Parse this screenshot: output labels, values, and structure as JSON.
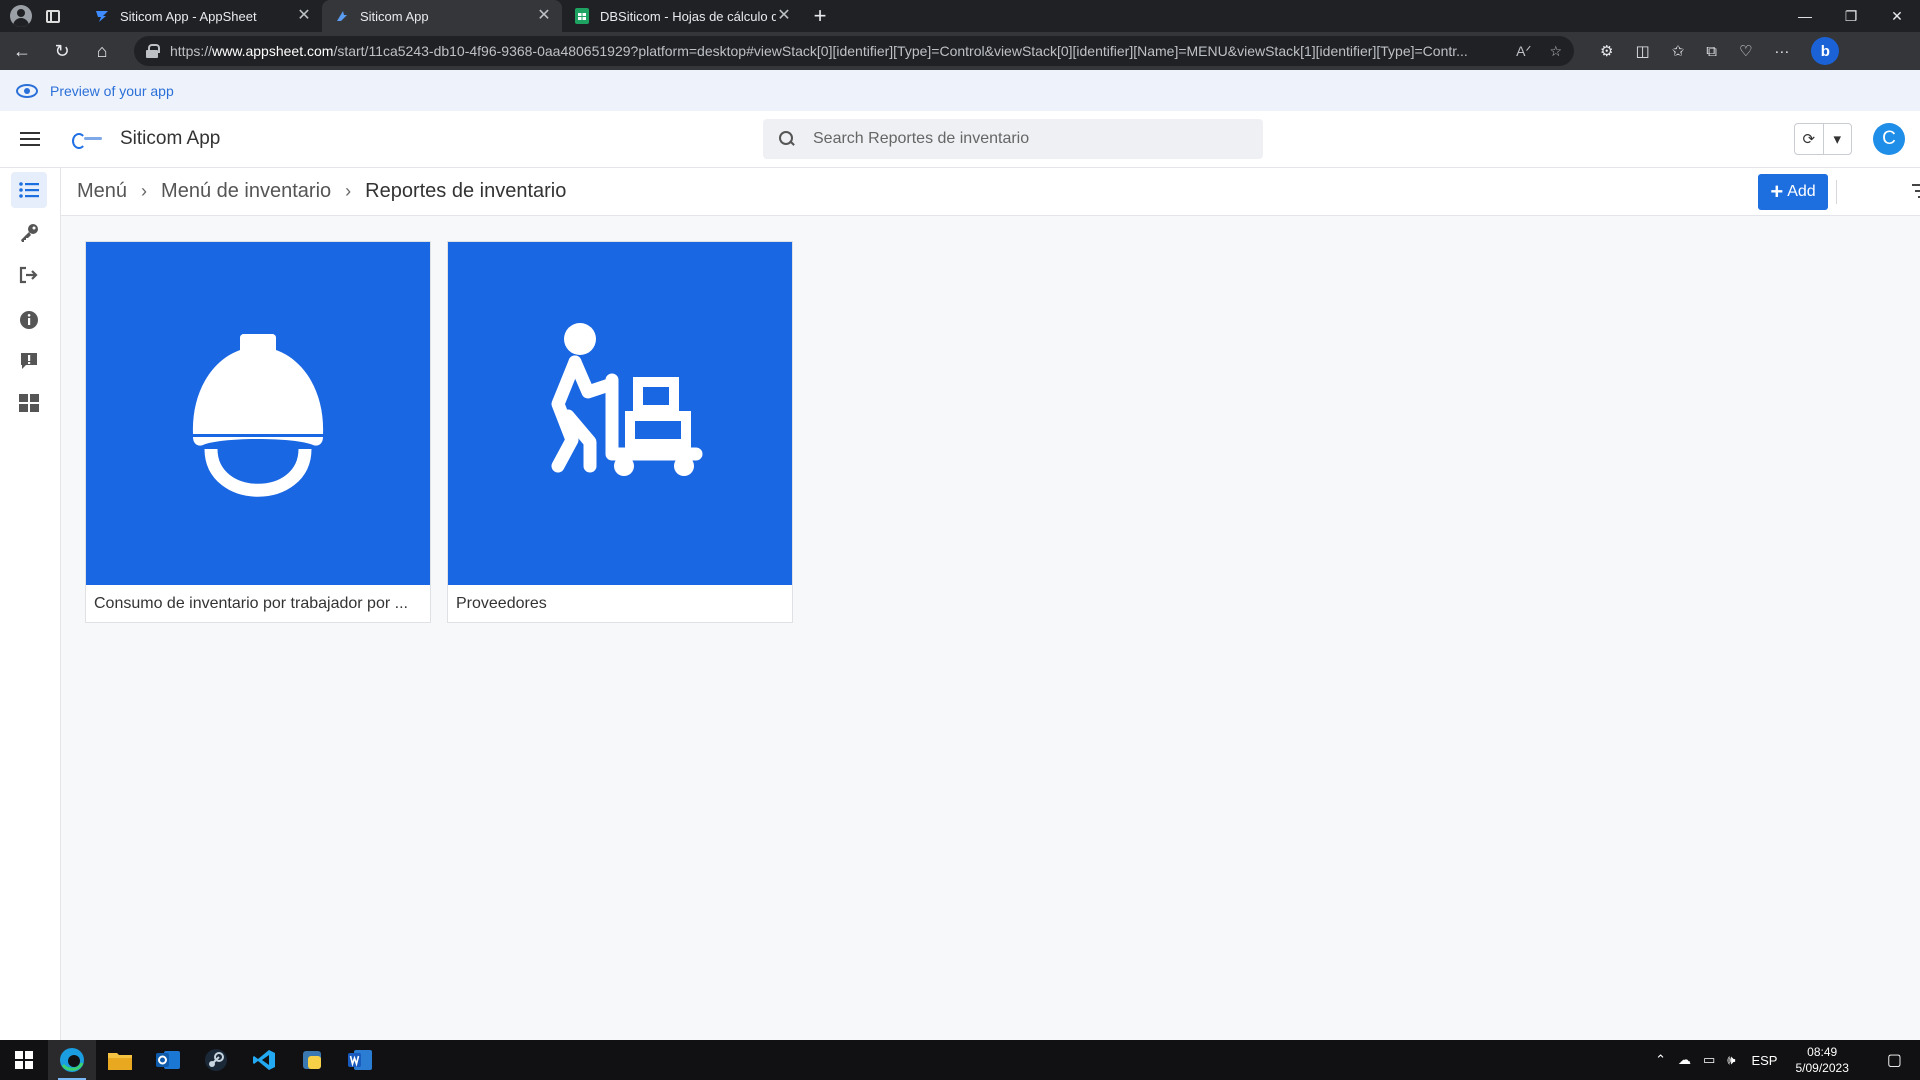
{
  "browser": {
    "tabs": [
      {
        "title": "Siticom App - AppSheet",
        "active": false
      },
      {
        "title": "Siticom App",
        "active": true
      },
      {
        "title": "DBSiticom - Hojas de cálculo de",
        "active": false
      }
    ],
    "url_host": "www.appsheet.com",
    "url_prefix": "https://",
    "url_rest": "/start/11ca5243-db10-4f96-9368-0aa480651929?platform=desktop#viewStack[0][identifier][Type]=Control&viewStack[0][identifier][Name]=MENU&viewStack[1][identifier][Type]=Contr..."
  },
  "preview_banner": {
    "text": "Preview of your app"
  },
  "app": {
    "name": "Siticom App",
    "search_placeholder": "Search Reportes de inventario",
    "avatar_letter": "C"
  },
  "breadcrumb": {
    "items": [
      "Menú",
      "Menú de inventario",
      "Reportes de inventario"
    ]
  },
  "actions": {
    "add_label": "Add"
  },
  "cards": [
    {
      "label": "Consumo de inventario por trabajador por ...",
      "icon": "hard-hat-icon"
    },
    {
      "label": "Proveedores",
      "icon": "worker-cart-icon"
    }
  ],
  "rail_icons": [
    "list-icon",
    "key-icon",
    "logout-icon",
    "info-icon",
    "feedback-icon",
    "grid-icon"
  ],
  "taskbar": {
    "language": "ESP",
    "time": "08:49",
    "date": "5/09/2023"
  },
  "colors": {
    "accent": "#1a67e3",
    "button": "#1d6fe0",
    "banner_text": "#2b6fd8"
  }
}
